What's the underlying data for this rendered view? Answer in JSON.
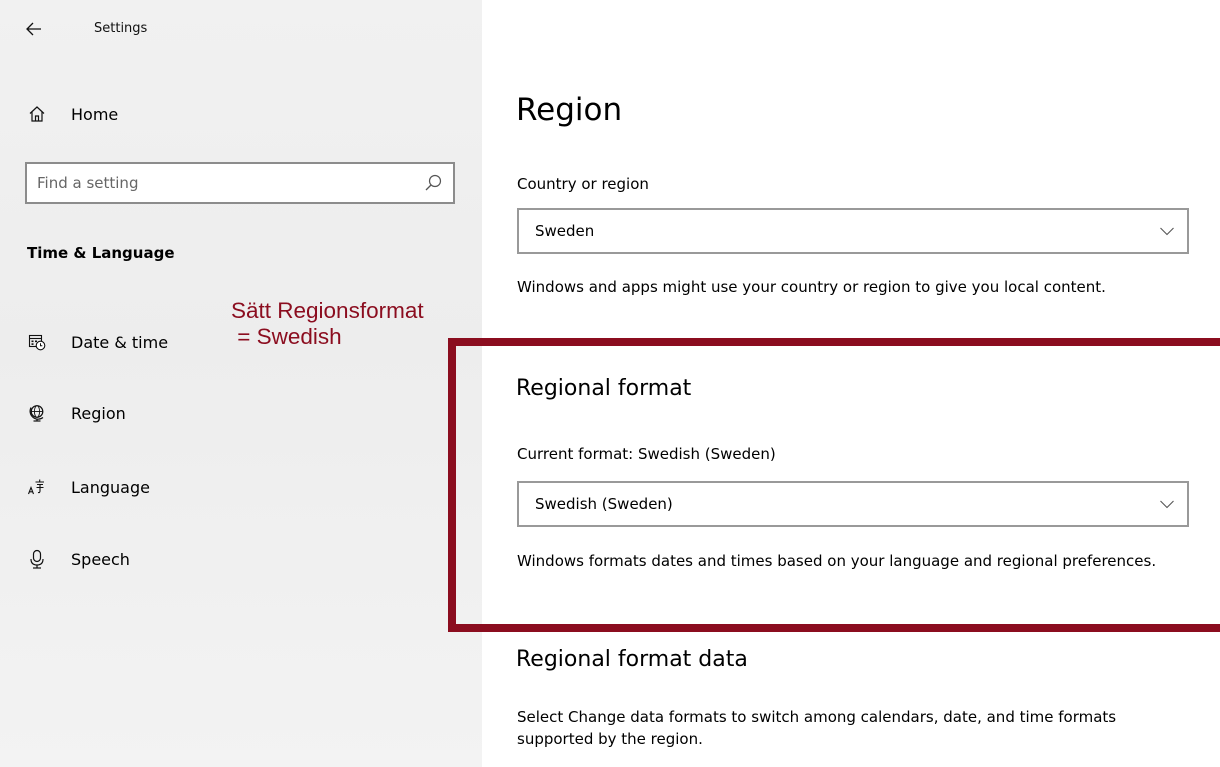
{
  "window": {
    "title": "Settings",
    "back_icon": "back-arrow-icon"
  },
  "sidebar": {
    "home": {
      "label": "Home",
      "icon": "home-icon"
    },
    "search": {
      "placeholder": "Find a setting",
      "value": "",
      "icon": "search-icon"
    },
    "section_heading": "Time & Language",
    "items": [
      {
        "label": "Date & time",
        "icon": "calendar-clock-icon"
      },
      {
        "label": "Region",
        "icon": "globe-icon"
      },
      {
        "label": "Language",
        "icon": "language-icon"
      },
      {
        "label": "Speech",
        "icon": "microphone-icon"
      }
    ]
  },
  "annotation": {
    "text": "Sätt Regionsformat\n = Swedish",
    "color": "#8b0d1f"
  },
  "main": {
    "title": "Region",
    "country": {
      "label": "Country or region",
      "selected": "Sweden",
      "description": "Windows and apps might use your country or region to give you local content."
    },
    "regional_format": {
      "heading": "Regional format",
      "label": "Current format: Swedish (Sweden)",
      "selected": "Swedish (Sweden)",
      "description": "Windows formats dates and times based on your language and regional preferences."
    },
    "regional_format_data": {
      "heading": "Regional format data",
      "description": "Select Change data formats to switch among calendars, date, and time formats supported by the region."
    }
  },
  "colors": {
    "highlight": "#8b0d1f",
    "sidebar_bg": "#f1f1f1",
    "border": "#999999"
  }
}
